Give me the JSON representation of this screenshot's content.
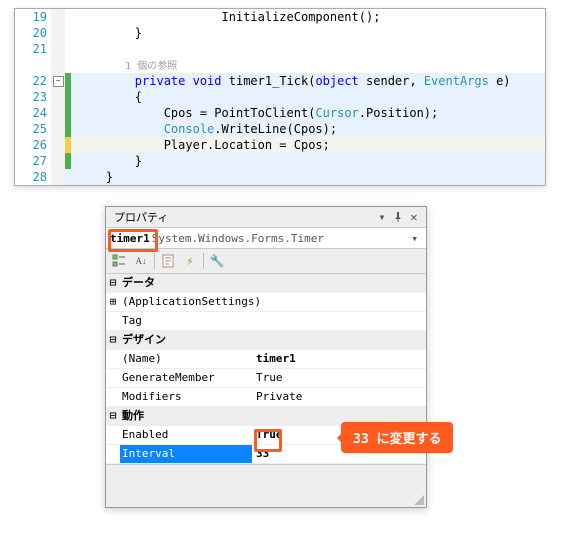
{
  "code": {
    "lines": [
      {
        "num": 19,
        "change": "",
        "fold": "",
        "hl": "",
        "segments": [
          {
            "t": "                    InitializeComponent();",
            "c": ""
          }
        ]
      },
      {
        "num": 20,
        "change": "",
        "fold": "",
        "hl": "",
        "segments": [
          {
            "t": "        }",
            "c": ""
          }
        ]
      },
      {
        "num": 21,
        "change": "",
        "fold": "",
        "hl": "",
        "segments": []
      },
      {
        "num": "",
        "change": "",
        "fold": "",
        "hl": "",
        "segments": [
          {
            "t": "        1 個の参照",
            "c": "ref-hint"
          }
        ]
      },
      {
        "num": 22,
        "change": "green",
        "fold": "-",
        "hl": "highlight",
        "segments": [
          {
            "t": "        ",
            "c": ""
          },
          {
            "t": "private",
            "c": "kw"
          },
          {
            "t": " ",
            "c": ""
          },
          {
            "t": "void",
            "c": "kw"
          },
          {
            "t": " timer1_Tick(",
            "c": ""
          },
          {
            "t": "object",
            "c": "kw"
          },
          {
            "t": " sender, ",
            "c": ""
          },
          {
            "t": "EventArgs",
            "c": "type"
          },
          {
            "t": " e)",
            "c": ""
          }
        ]
      },
      {
        "num": 23,
        "change": "green",
        "fold": "",
        "hl": "highlight",
        "segments": [
          {
            "t": "        {",
            "c": ""
          }
        ]
      },
      {
        "num": 24,
        "change": "green",
        "fold": "",
        "hl": "highlight",
        "segments": [
          {
            "t": "            Cpos = PointToClient(",
            "c": ""
          },
          {
            "t": "Cursor",
            "c": "type"
          },
          {
            "t": ".Position);",
            "c": ""
          }
        ]
      },
      {
        "num": 25,
        "change": "green",
        "fold": "",
        "hl": "highlight",
        "segments": [
          {
            "t": "            ",
            "c": ""
          },
          {
            "t": "Console",
            "c": "type"
          },
          {
            "t": ".WriteLine(Cpos);",
            "c": ""
          }
        ]
      },
      {
        "num": 26,
        "change": "yellow",
        "fold": "",
        "hl": "current",
        "segments": [
          {
            "t": "            Player.Location = Cpos;",
            "c": ""
          }
        ]
      },
      {
        "num": 27,
        "change": "green",
        "fold": "",
        "hl": "highlight",
        "segments": [
          {
            "t": "        }",
            "c": ""
          }
        ]
      },
      {
        "num": 28,
        "change": "",
        "fold": "",
        "hl": "highlight",
        "segments": [
          {
            "t": "    }",
            "c": ""
          }
        ]
      }
    ]
  },
  "properties": {
    "title": "プロパティ",
    "object_name": "timer1",
    "object_type": "System.Windows.Forms.Timer",
    "rows": [
      {
        "kind": "cat",
        "expand": "⊟",
        "label": "データ",
        "value": ""
      },
      {
        "kind": "prop",
        "expand": "⊞",
        "label": "(ApplicationSettings)",
        "value": ""
      },
      {
        "kind": "prop",
        "expand": "",
        "label": "Tag",
        "value": ""
      },
      {
        "kind": "cat",
        "expand": "⊟",
        "label": "デザイン",
        "value": ""
      },
      {
        "kind": "prop",
        "expand": "",
        "label": "(Name)",
        "value": "timer1",
        "bold": true
      },
      {
        "kind": "prop",
        "expand": "",
        "label": "GenerateMember",
        "value": "True"
      },
      {
        "kind": "prop",
        "expand": "",
        "label": "Modifiers",
        "value": "Private"
      },
      {
        "kind": "cat",
        "expand": "⊟",
        "label": "動作",
        "value": ""
      },
      {
        "kind": "prop",
        "expand": "",
        "label": "Enabled",
        "value": "True",
        "bold": true
      },
      {
        "kind": "prop",
        "expand": "",
        "label": "Interval",
        "value": "33",
        "selected": true
      }
    ]
  },
  "callout": "33 に変更する"
}
